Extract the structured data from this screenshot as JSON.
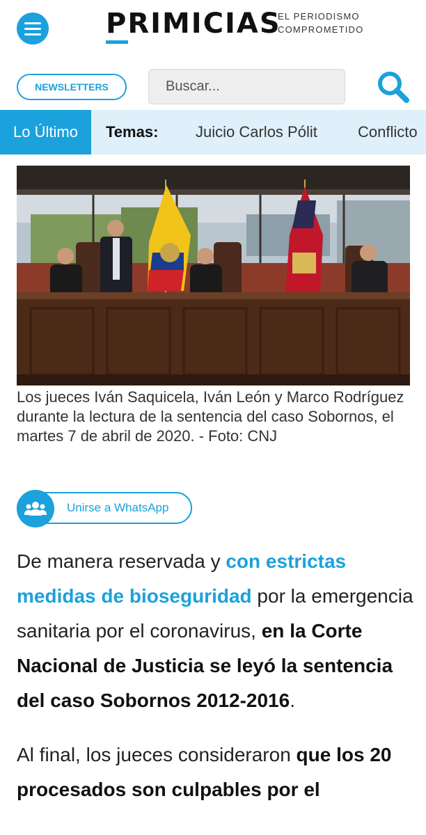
{
  "header": {
    "logo": "PRIMICIAS",
    "tagline_line1": "EL PERIODISMO",
    "tagline_line2": "COMPROMETIDO"
  },
  "toolbar": {
    "newsletters_label": "NEWSLETTERS",
    "search_placeholder": "Buscar..."
  },
  "nav": {
    "latest": "Lo Último",
    "topics_label": "Temas:",
    "items": [
      "Juicio Carlos Pólit",
      "Conflicto"
    ]
  },
  "photo": {
    "caption": "Los jueces Iván Saquicela, Iván León y Marco Rodríguez durante la lectura de la sentencia del caso Sobornos, el martes 7 de abril de 2020. - Foto: CNJ"
  },
  "whatsapp": {
    "label": "Unirse a WhatsApp"
  },
  "article": {
    "p1_a": "De manera reservada y ",
    "p1_b": "con estrictas medidas de bioseguridad",
    "p1_c": " por la emergencia sanitaria por el coronavirus, ",
    "p1_d": "en la Corte Nacional de Justicia se leyó la sentencia del caso Sobornos 2012-2016",
    "p1_e": ".",
    "p2_a": "Al final, los jueces consideraron ",
    "p2_b": "que los 20 procesados son culpables por el"
  },
  "colors": {
    "accent": "#1ba1dc",
    "nav_bg": "#dff0fb"
  }
}
